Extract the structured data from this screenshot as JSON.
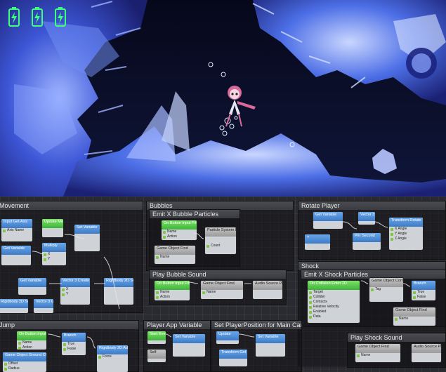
{
  "battery_icons": [
    "battery-charging-icon",
    "battery-charging-icon",
    "battery-charging-icon"
  ],
  "colors": {
    "battery": "#3dff7a",
    "graph_bg": "#2a2b30",
    "node_blue": "#3d7bc7",
    "node_green": "#3fb43a"
  },
  "groups": {
    "movement": "Movement",
    "bubbles": "Bubbles",
    "emit_bubble": "Emit X Bubble Particles",
    "rotate_player": "Rotate Player",
    "play_bubble_sound": "Play Bubble Sound",
    "shock": "Shock",
    "emit_shock": "Emit X Shock Particles",
    "jump": "Jump",
    "player_app_variable": "Player App Variable",
    "set_player_position": "Set PlayerPosition for Main Camera",
    "play_shock_sound": "Play Shock Sound"
  },
  "nodes": {
    "movement": [
      {
        "title": "Input\nGet Axis",
        "rows": [
          "Axis Name"
        ]
      },
      {
        "title": "Update\nMoves",
        "rows": [
          ""
        ]
      },
      {
        "title": "Set Variable",
        "rows": [
          ""
        ]
      },
      {
        "title": "Get Variable",
        "rows": [
          ""
        ]
      },
      {
        "title": "Multiply",
        "rows": [
          "X",
          "Y"
        ]
      },
      {
        "title": "Get Variable",
        "rows": [
          ""
        ]
      },
      {
        "title": "Vector 3\nCreate Vector 3",
        "rows": [
          "X",
          "Y",
          "Z"
        ]
      },
      {
        "title": "Rigidbody 2D\nSet Velocity",
        "rows": [
          ""
        ]
      },
      {
        "title": "Rigidbody 2D\nSet Velocity",
        "rows": [
          ""
        ]
      },
      {
        "title": "Vector 3\nGet X",
        "rows": [
          ""
        ]
      }
    ],
    "bubbles": [
      {
        "title": "On Button Input\nFire2",
        "rows": [
          "Name",
          "Action"
        ]
      },
      {
        "title": "Particle System\nEmit",
        "rows": [
          ""
        ]
      },
      {
        "title": "Game Object\nFind",
        "rows": [
          "Name"
        ]
      },
      {
        "title": "Count",
        "rows": [
          "Count"
        ]
      },
      {
        "title": "On Button Input\nFire2",
        "rows": [
          "Name",
          "Action"
        ]
      },
      {
        "title": "Game Object\nFind",
        "rows": [
          "Name"
        ]
      },
      {
        "title": "Audio Source\nPlay",
        "rows": [
          ""
        ]
      }
    ],
    "rotate": [
      {
        "title": "Get Variable",
        "rows": [
          ""
        ]
      },
      {
        "title": "Vector 3\nGet X",
        "rows": [
          ""
        ]
      },
      {
        "title": "Transform\nRotate",
        "rows": [
          "X Angle",
          "Y Angle",
          "Z Angle"
        ]
      },
      {
        "title": "Per Second",
        "rows": [
          ""
        ]
      }
    ],
    "shock": [
      {
        "title": "On Collision Enter 2D",
        "rows": [
          "Target",
          "Collider",
          "Contacts",
          "Relative Velocity",
          "Enabled",
          "Data"
        ]
      },
      {
        "title": "Game Object\nCompare Tag",
        "rows": [
          "Tag"
        ]
      },
      {
        "title": "Branch",
        "rows": [
          "True",
          "False"
        ]
      },
      {
        "title": "Game Object\nFind",
        "rows": [
          "Name"
        ]
      },
      {
        "title": "Game Object\nFind",
        "rows": [
          "Name"
        ]
      },
      {
        "title": "Audio Source\nPlay",
        "rows": [
          ""
        ]
      }
    ],
    "jump": [
      {
        "title": "On Button Input\nJump",
        "rows": [
          "Name",
          "Action"
        ]
      },
      {
        "title": "Branch",
        "rows": [
          "True",
          "False"
        ]
      },
      {
        "title": "Rigidbody 2D\nAdd Force",
        "rows": [
          "Force"
        ]
      },
      {
        "title": "Game Object\nGround Check",
        "rows": [
          "Offset",
          "Grounded",
          "Radius"
        ]
      },
      {
        "title": "Start\nEvent",
        "rows": [
          ""
        ]
      },
      {
        "title": "Self",
        "rows": [
          ""
        ]
      },
      {
        "title": "Set Variable",
        "rows": [
          ""
        ]
      },
      {
        "title": "Update",
        "rows": [
          ""
        ]
      },
      {
        "title": "Set Variable",
        "rows": [
          ""
        ]
      },
      {
        "title": "Transform\nGet Position",
        "rows": [
          ""
        ]
      }
    ]
  }
}
